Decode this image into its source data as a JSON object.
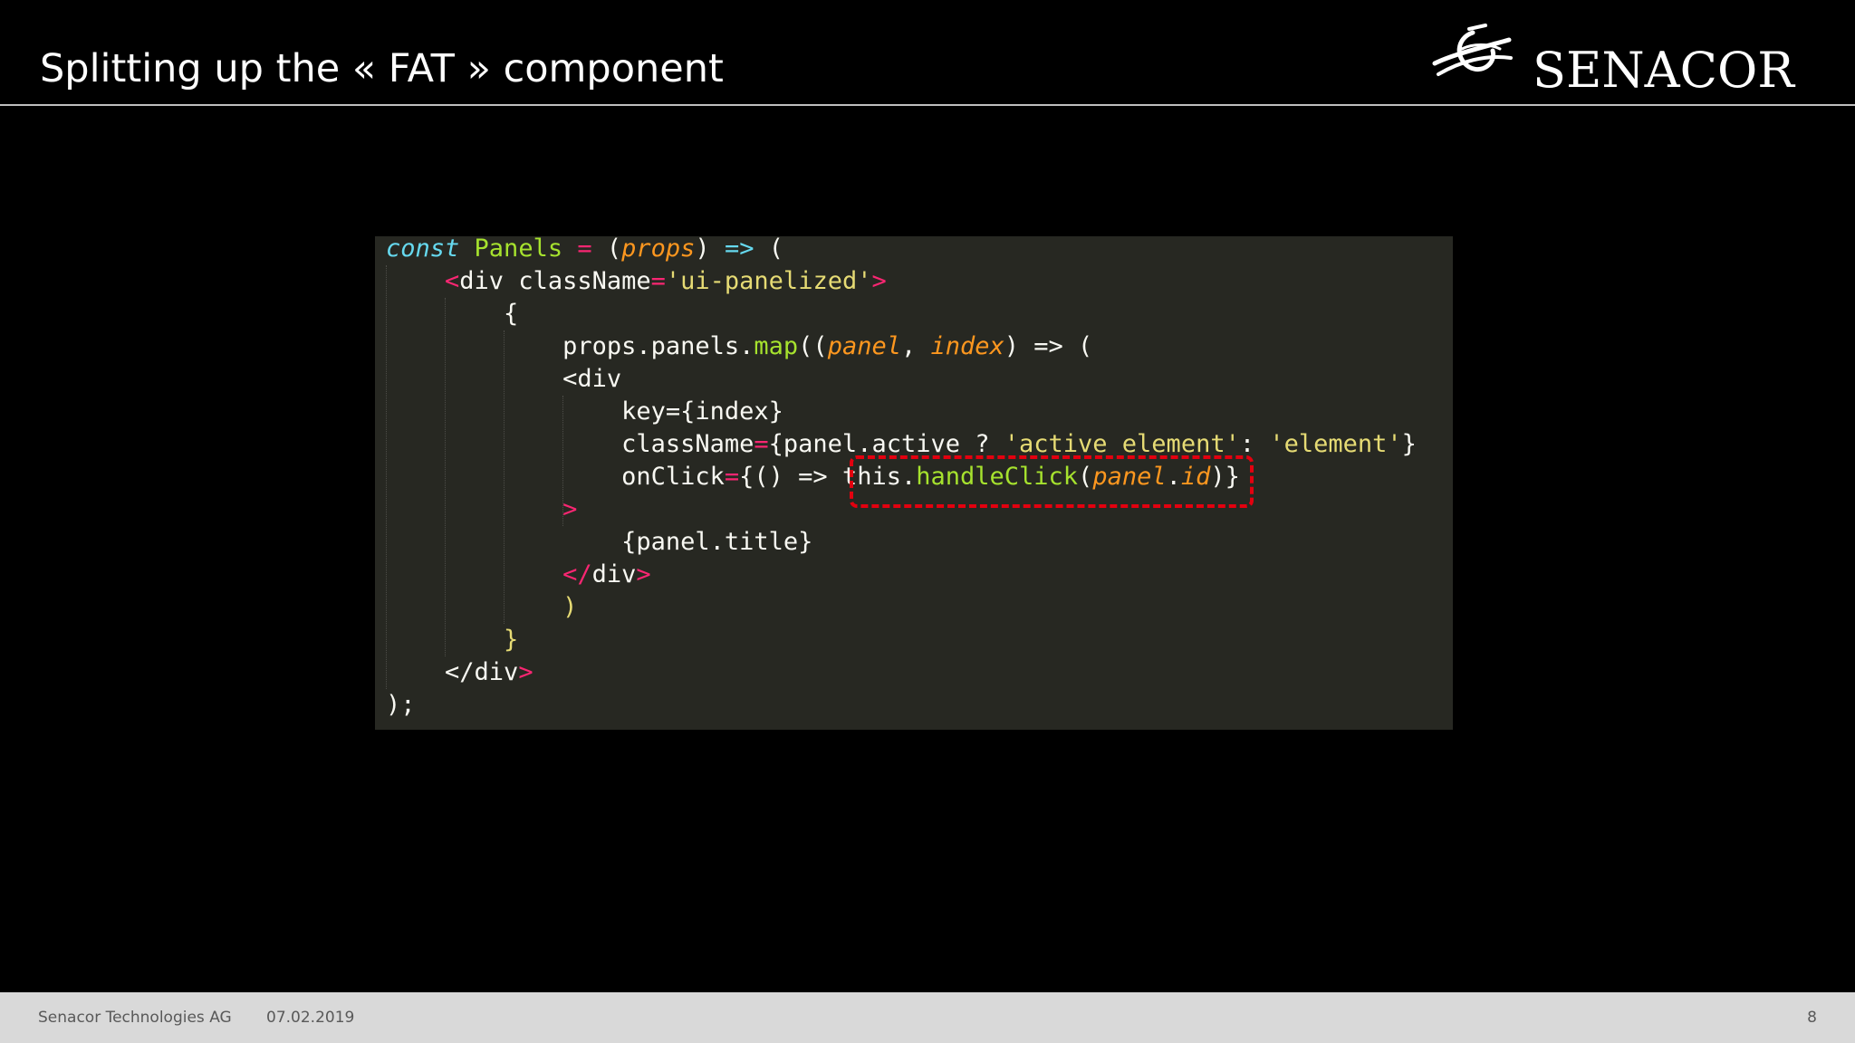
{
  "slide": {
    "title": "Splitting up the « FAT » component"
  },
  "logo": {
    "text": "SENACOR",
    "mark_icon": "senacor-swirl-icon"
  },
  "code": {
    "lines": [
      [
        {
          "t": "const",
          "c": "kw"
        },
        {
          "t": " ",
          "c": "pl"
        },
        {
          "t": "Panels",
          "c": "fn"
        },
        {
          "t": " ",
          "c": "pl"
        },
        {
          "t": "=",
          "c": "op"
        },
        {
          "t": " (",
          "c": "pl"
        },
        {
          "t": "props",
          "c": "pa"
        },
        {
          "t": ") ",
          "c": "pl"
        },
        {
          "t": "=>",
          "c": "kw"
        },
        {
          "t": " (",
          "c": "pl"
        }
      ],
      [
        {
          "t": "    ",
          "c": "pl"
        },
        {
          "t": "<",
          "c": "op"
        },
        {
          "t": "div className",
          "c": "pl"
        },
        {
          "t": "=",
          "c": "op"
        },
        {
          "t": "'ui-panelized'",
          "c": "st"
        },
        {
          "t": ">",
          "c": "op"
        }
      ],
      [
        {
          "t": "        {",
          "c": "pl"
        }
      ],
      [
        {
          "t": "            props.panels.",
          "c": "pl"
        },
        {
          "t": "map",
          "c": "fn"
        },
        {
          "t": "((",
          "c": "pl"
        },
        {
          "t": "panel",
          "c": "pa"
        },
        {
          "t": ", ",
          "c": "pl"
        },
        {
          "t": "index",
          "c": "pa"
        },
        {
          "t": ") => (",
          "c": "pl"
        }
      ],
      [
        {
          "t": "            <div",
          "c": "pl"
        }
      ],
      [
        {
          "t": "                key={index}",
          "c": "pl"
        }
      ],
      [
        {
          "t": "                className",
          "c": "pl"
        },
        {
          "t": "=",
          "c": "op"
        },
        {
          "t": "{panel.active ? ",
          "c": "pl"
        },
        {
          "t": "'active element'",
          "c": "st"
        },
        {
          "t": ": ",
          "c": "pl"
        },
        {
          "t": "'element'",
          "c": "st"
        },
        {
          "t": "}",
          "c": "pl"
        }
      ],
      [
        {
          "t": "                onClick",
          "c": "pl"
        },
        {
          "t": "=",
          "c": "op"
        },
        {
          "t": "{() => ",
          "c": "pl"
        },
        {
          "t": "this",
          "c": "pl"
        },
        {
          "t": ".",
          "c": "pl"
        },
        {
          "t": "handleClick",
          "c": "fn"
        },
        {
          "t": "(",
          "c": "pl"
        },
        {
          "t": "panel",
          "c": "pa"
        },
        {
          "t": ".",
          "c": "pl"
        },
        {
          "t": "id",
          "c": "pa"
        },
        {
          "t": ")}",
          "c": "pl"
        }
      ],
      [
        {
          "t": "            ",
          "c": "pl"
        },
        {
          "t": ">",
          "c": "op"
        }
      ],
      [
        {
          "t": "                {panel.title}",
          "c": "pl"
        }
      ],
      [
        {
          "t": "            ",
          "c": "pl"
        },
        {
          "t": "</",
          "c": "op"
        },
        {
          "t": "div",
          "c": "pl"
        },
        {
          "t": ">",
          "c": "op"
        }
      ],
      [
        {
          "t": "            ",
          "c": "pl"
        },
        {
          "t": ")",
          "c": "st"
        }
      ],
      [
        {
          "t": "        ",
          "c": "pl"
        },
        {
          "t": "}",
          "c": "st"
        }
      ],
      [
        {
          "t": "    </div",
          "c": "pl"
        },
        {
          "t": ">",
          "c": "op"
        }
      ],
      [
        {
          "t": ");",
          "c": "pl"
        }
      ]
    ]
  },
  "footer": {
    "company": "Senacor Technologies AG",
    "date": "07.02.2019",
    "page_number": "8"
  },
  "colors": {
    "background": "#000000",
    "code_background": "#272822",
    "highlight": "#e3000f",
    "footer_background": "#d9d9d9"
  }
}
